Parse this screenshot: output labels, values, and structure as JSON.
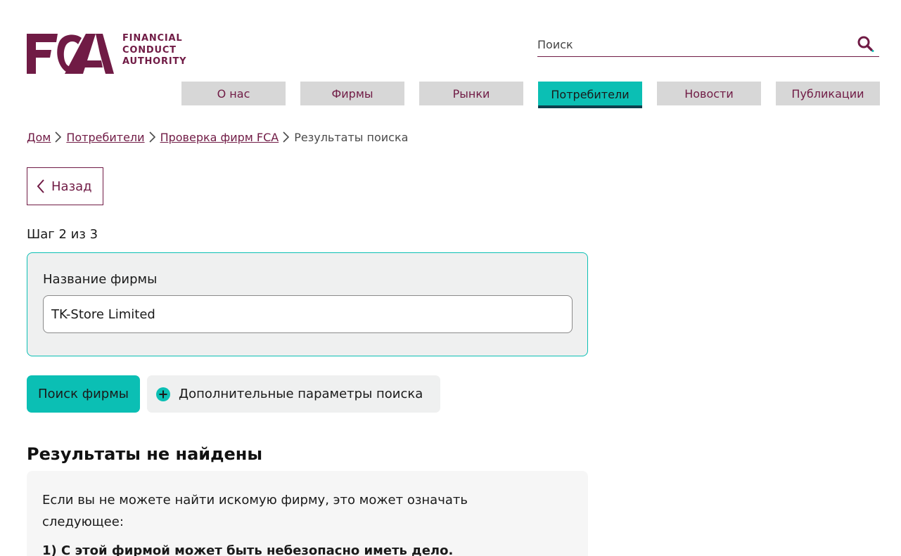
{
  "logo": {
    "lines": [
      "FINANCIAL",
      "CONDUCT",
      "AUTHORITY"
    ],
    "brand_color": "#701b45"
  },
  "search": {
    "placeholder": "Поиск",
    "icon": "search-icon"
  },
  "nav": {
    "items": [
      {
        "label": "О нас"
      },
      {
        "label": "Фирмы"
      },
      {
        "label": "Рынки"
      },
      {
        "label": "Потребители"
      },
      {
        "label": "Новости"
      },
      {
        "label": "Публикации"
      }
    ],
    "active_index": 3,
    "active_color": "#0bbfb4"
  },
  "breadcrumb": {
    "items": [
      "Дом",
      "Потребители",
      "Проверка фирм FCA"
    ],
    "current": "Результаты поиска"
  },
  "back_label": "Назад",
  "step_text": "Шаг 2 из 3",
  "form": {
    "firm_name_label": "Название фирмы",
    "firm_name_value": "TK-Store Limited"
  },
  "buttons": {
    "search_firm": "Поиск фирмы",
    "advanced": "Дополнительные параметры поиска"
  },
  "results": {
    "title": "Результаты не найдены",
    "intro": "Если вы не можете найти искомую фирму, это может означать следующее:",
    "reason_1": "1) С этой фирмой может быть небезопасно иметь дело."
  }
}
